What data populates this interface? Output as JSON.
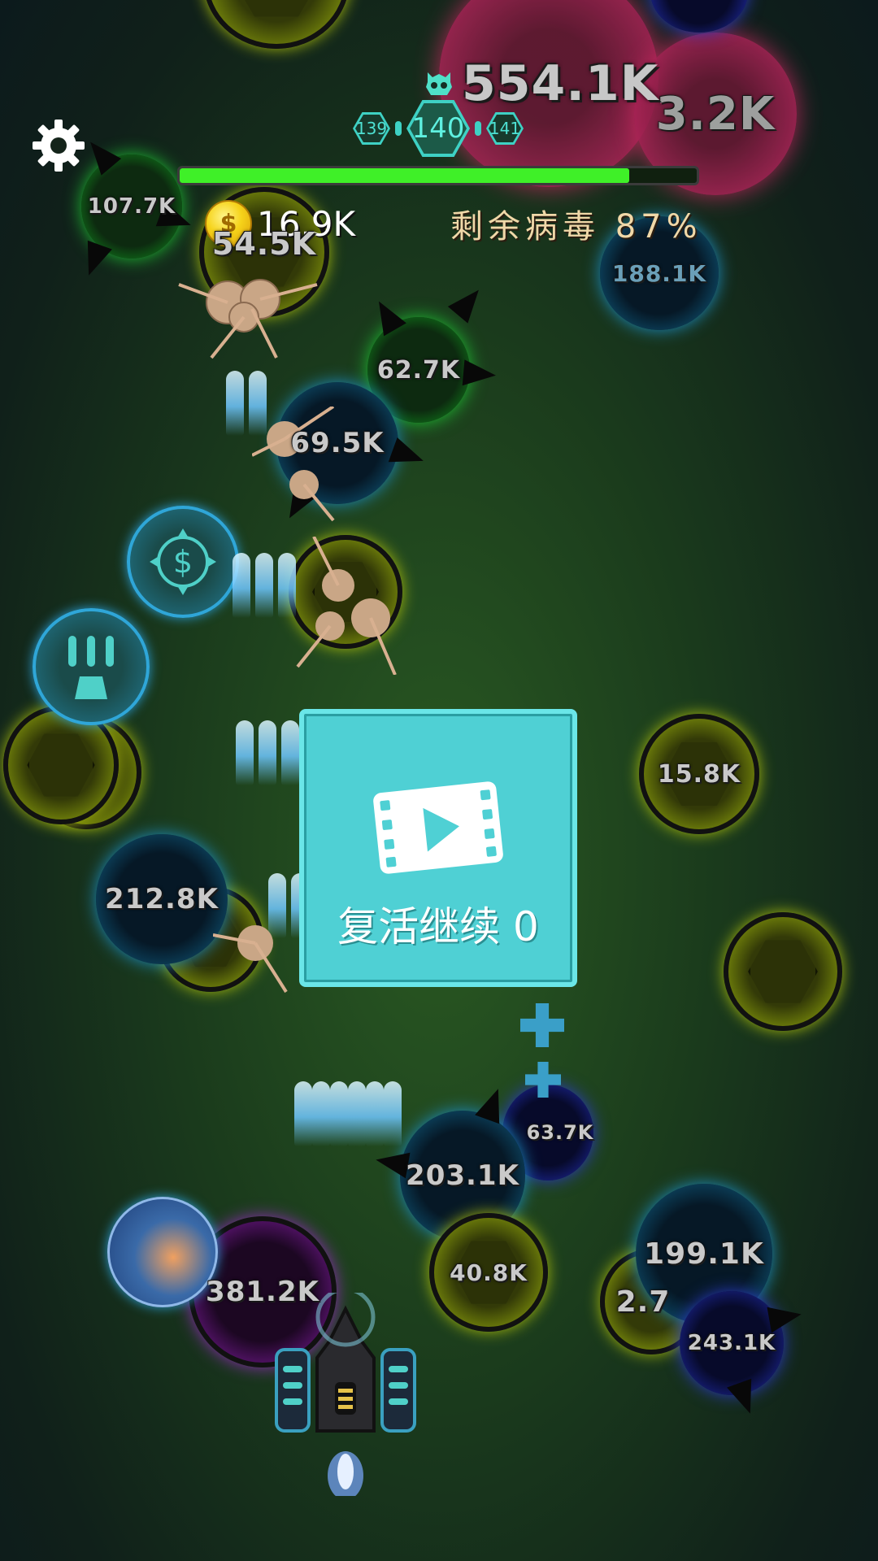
{
  "hud": {
    "score": "554.1K",
    "levels": {
      "prev": "139",
      "current": "140",
      "next": "141"
    },
    "progress_percent": 87,
    "coins": "16.9K",
    "remaining_label": "剩余病毒 87%"
  },
  "revive": {
    "label": "复活继续 0"
  },
  "viruses": {
    "red_big": "554.1K",
    "red_right": "3.2K",
    "green_topleft": "107.7K",
    "yellow_top": "54.5K",
    "blue_topright": "188.1K",
    "green_mid": "62.7K",
    "blue_mid": "69.5K",
    "yellow_mid": "",
    "yellow_right": "15.8K",
    "blue_left": "212.8K",
    "navy_small": "63.7K",
    "blue_bottom": "203.1K",
    "purple_bottom": "381.2K",
    "yellow_bottom": "40.8K",
    "blue_bottomright": "199.1K",
    "yellow_bottomright": "2.7",
    "navy_bottomright": "243.1K"
  },
  "colors": {
    "accent": "#4fd0d4",
    "progress": "#3ff028",
    "coin": "#f6d31a"
  },
  "icons": [
    "settings-gear-icon",
    "skull-icon",
    "coin-icon",
    "video-play-icon",
    "dollar-powerup-icon",
    "rapid-fire-powerup-icon",
    "plus-powerup-icon"
  ]
}
